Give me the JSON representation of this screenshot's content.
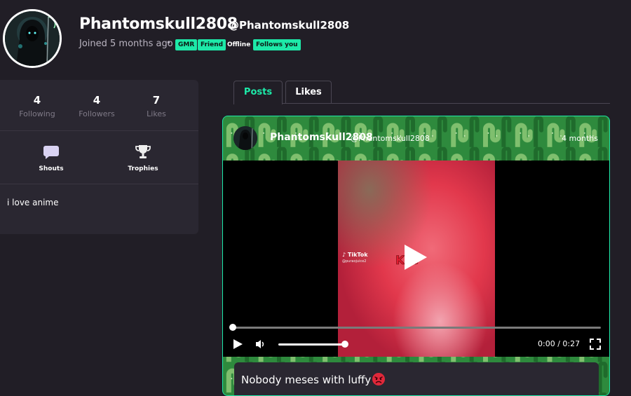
{
  "profile": {
    "username": "Phantomskull2808",
    "handle": "@Phantomskull2808",
    "joined": "Joined 5 months ago",
    "separator": "•",
    "badges": [
      "GMR",
      "Friend"
    ],
    "status": "Offline",
    "follows_badge": "Follows you"
  },
  "stats": [
    {
      "value": "4",
      "label": "Following"
    },
    {
      "value": "4",
      "label": "Followers"
    },
    {
      "value": "7",
      "label": "Likes"
    }
  ],
  "sidebar_buttons": {
    "shouts": "Shouts",
    "trophies": "Trophies"
  },
  "bio": "i love anime",
  "tabs": {
    "posts": "Posts",
    "likes": "Likes"
  },
  "post": {
    "username": "Phantomskull2808",
    "handle": "@Phantomskull2808",
    "time": "4 months",
    "video": {
      "watermark": "TikTok",
      "watermark_user": "@puraojuice2",
      "time": "0:00 / 0:27",
      "progress": 0,
      "volume": 0.9
    },
    "caption": "Nobody meses with luffy"
  },
  "colors": {
    "accent": "#1de9a8",
    "background": "#211e26",
    "card": "#2a2731",
    "post_bg": "#2f8a3e"
  }
}
